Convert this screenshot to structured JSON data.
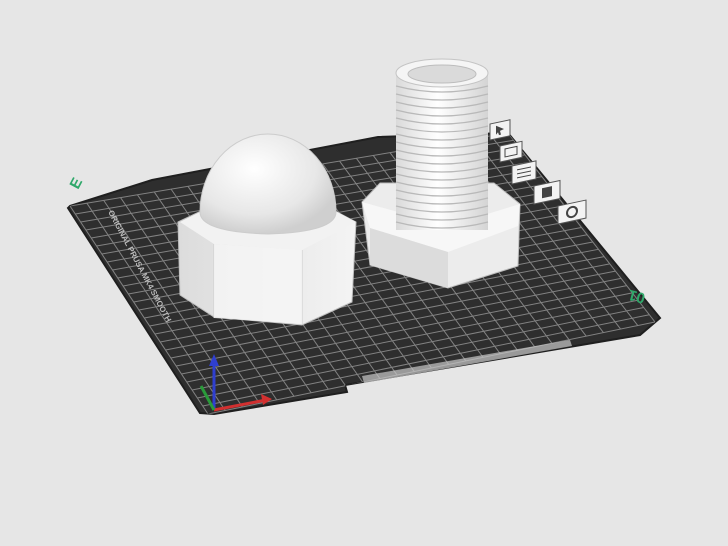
{
  "scene": {
    "bed_label": "ORIGINAL PRUSA MK4 SMOOTH",
    "corner_left_label": "E",
    "corner_right_label": "01",
    "objects": [
      "acorn-nut",
      "threaded-bolt"
    ]
  },
  "toolbar": {
    "buttons": [
      {
        "name": "move-tool-button",
        "icon": "cursor-icon"
      },
      {
        "name": "scale-tool-button",
        "icon": "scale-icon"
      },
      {
        "name": "layers-tool-button",
        "icon": "layers-icon"
      },
      {
        "name": "support-tool-button",
        "icon": "support-icon"
      },
      {
        "name": "settings-tool-button",
        "icon": "gear-icon"
      }
    ]
  },
  "colors": {
    "background": "#e6e6e6",
    "bed": "#2e2e2e",
    "grid": "#8c8c8c",
    "object": "#f3f3f3",
    "axis_x": "#d23030",
    "axis_y": "#2a9a3a",
    "axis_z": "#2f3fd0",
    "accent": "#2fa86a"
  }
}
